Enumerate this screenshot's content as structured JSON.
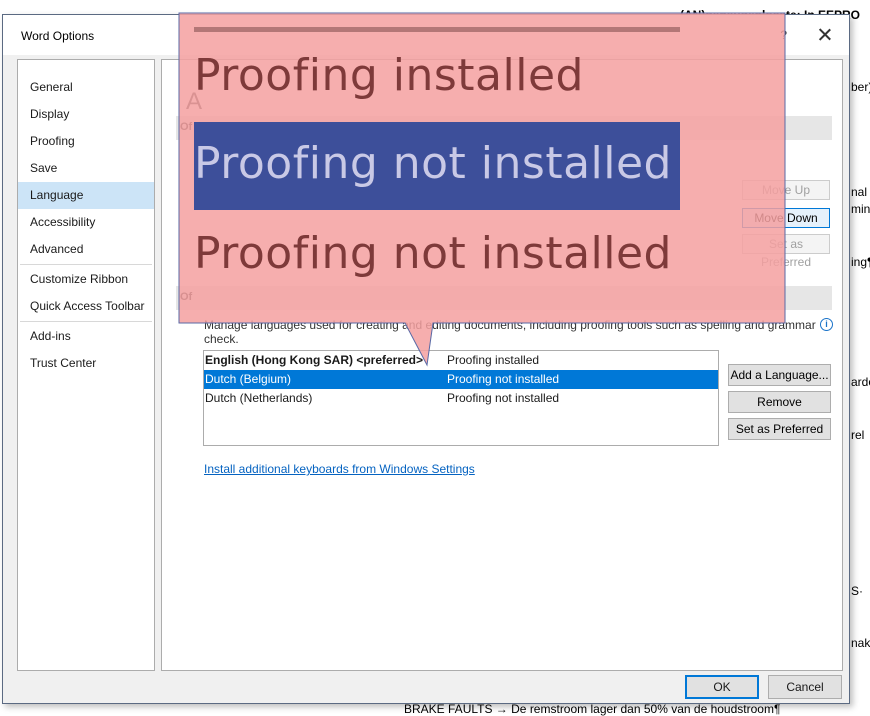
{
  "background_doc": {
    "frag1": "(AN)geneugenlocate: In EEPRO",
    "frag2": "ber)",
    "frag3": "nal",
    "frag4": "mina",
    "frag5": "ing¶",
    "frag6": "ardo",
    "frag7": "rel",
    "frag8": "S·",
    "frag9": "nake",
    "footer": "BRAKE FAULTS  →  De remstroom  lager dan 50% van de houdstroom¶"
  },
  "dialog": {
    "title": "Word Options",
    "help": "?",
    "ok": "OK",
    "cancel": "Cancel"
  },
  "sidebar": {
    "items": [
      {
        "label": "General"
      },
      {
        "label": "Display"
      },
      {
        "label": "Proofing"
      },
      {
        "label": "Save"
      },
      {
        "label": "Language"
      },
      {
        "label": "Accessibility"
      },
      {
        "label": "Advanced"
      },
      {
        "label": "Customize Ribbon"
      },
      {
        "label": "Quick Access Toolbar"
      },
      {
        "label": "Add-ins"
      },
      {
        "label": "Trust Center"
      }
    ],
    "selected": "Language"
  },
  "content": {
    "heading_fragment": "A",
    "section1_fragment": "Of",
    "section2_fragment": "Of",
    "move_up": "Move Up",
    "move_down": "Move Down",
    "set_preferred_top": "Set as Preferred",
    "description": "Manage languages used for creating and editing documents, including proofing tools such as spelling and grammar check.",
    "info": "i",
    "languages": [
      {
        "name": "English (Hong Kong SAR) <preferred>",
        "status": "Proofing installed"
      },
      {
        "name": "Dutch (Belgium)",
        "status": "Proofing not installed"
      },
      {
        "name": "Dutch (Netherlands)",
        "status": "Proofing not installed"
      }
    ],
    "add_language": "Add a Language...",
    "remove": "Remove",
    "set_preferred": "Set as Preferred",
    "install_link": "Install additional keyboards from Windows Settings"
  },
  "callout": {
    "line1": "Proofing installed",
    "line2": "Proofing not installed",
    "line3": "Proofing not installed",
    "fill_color": "#f5a0a0",
    "band_color": "#3d4f9a"
  }
}
